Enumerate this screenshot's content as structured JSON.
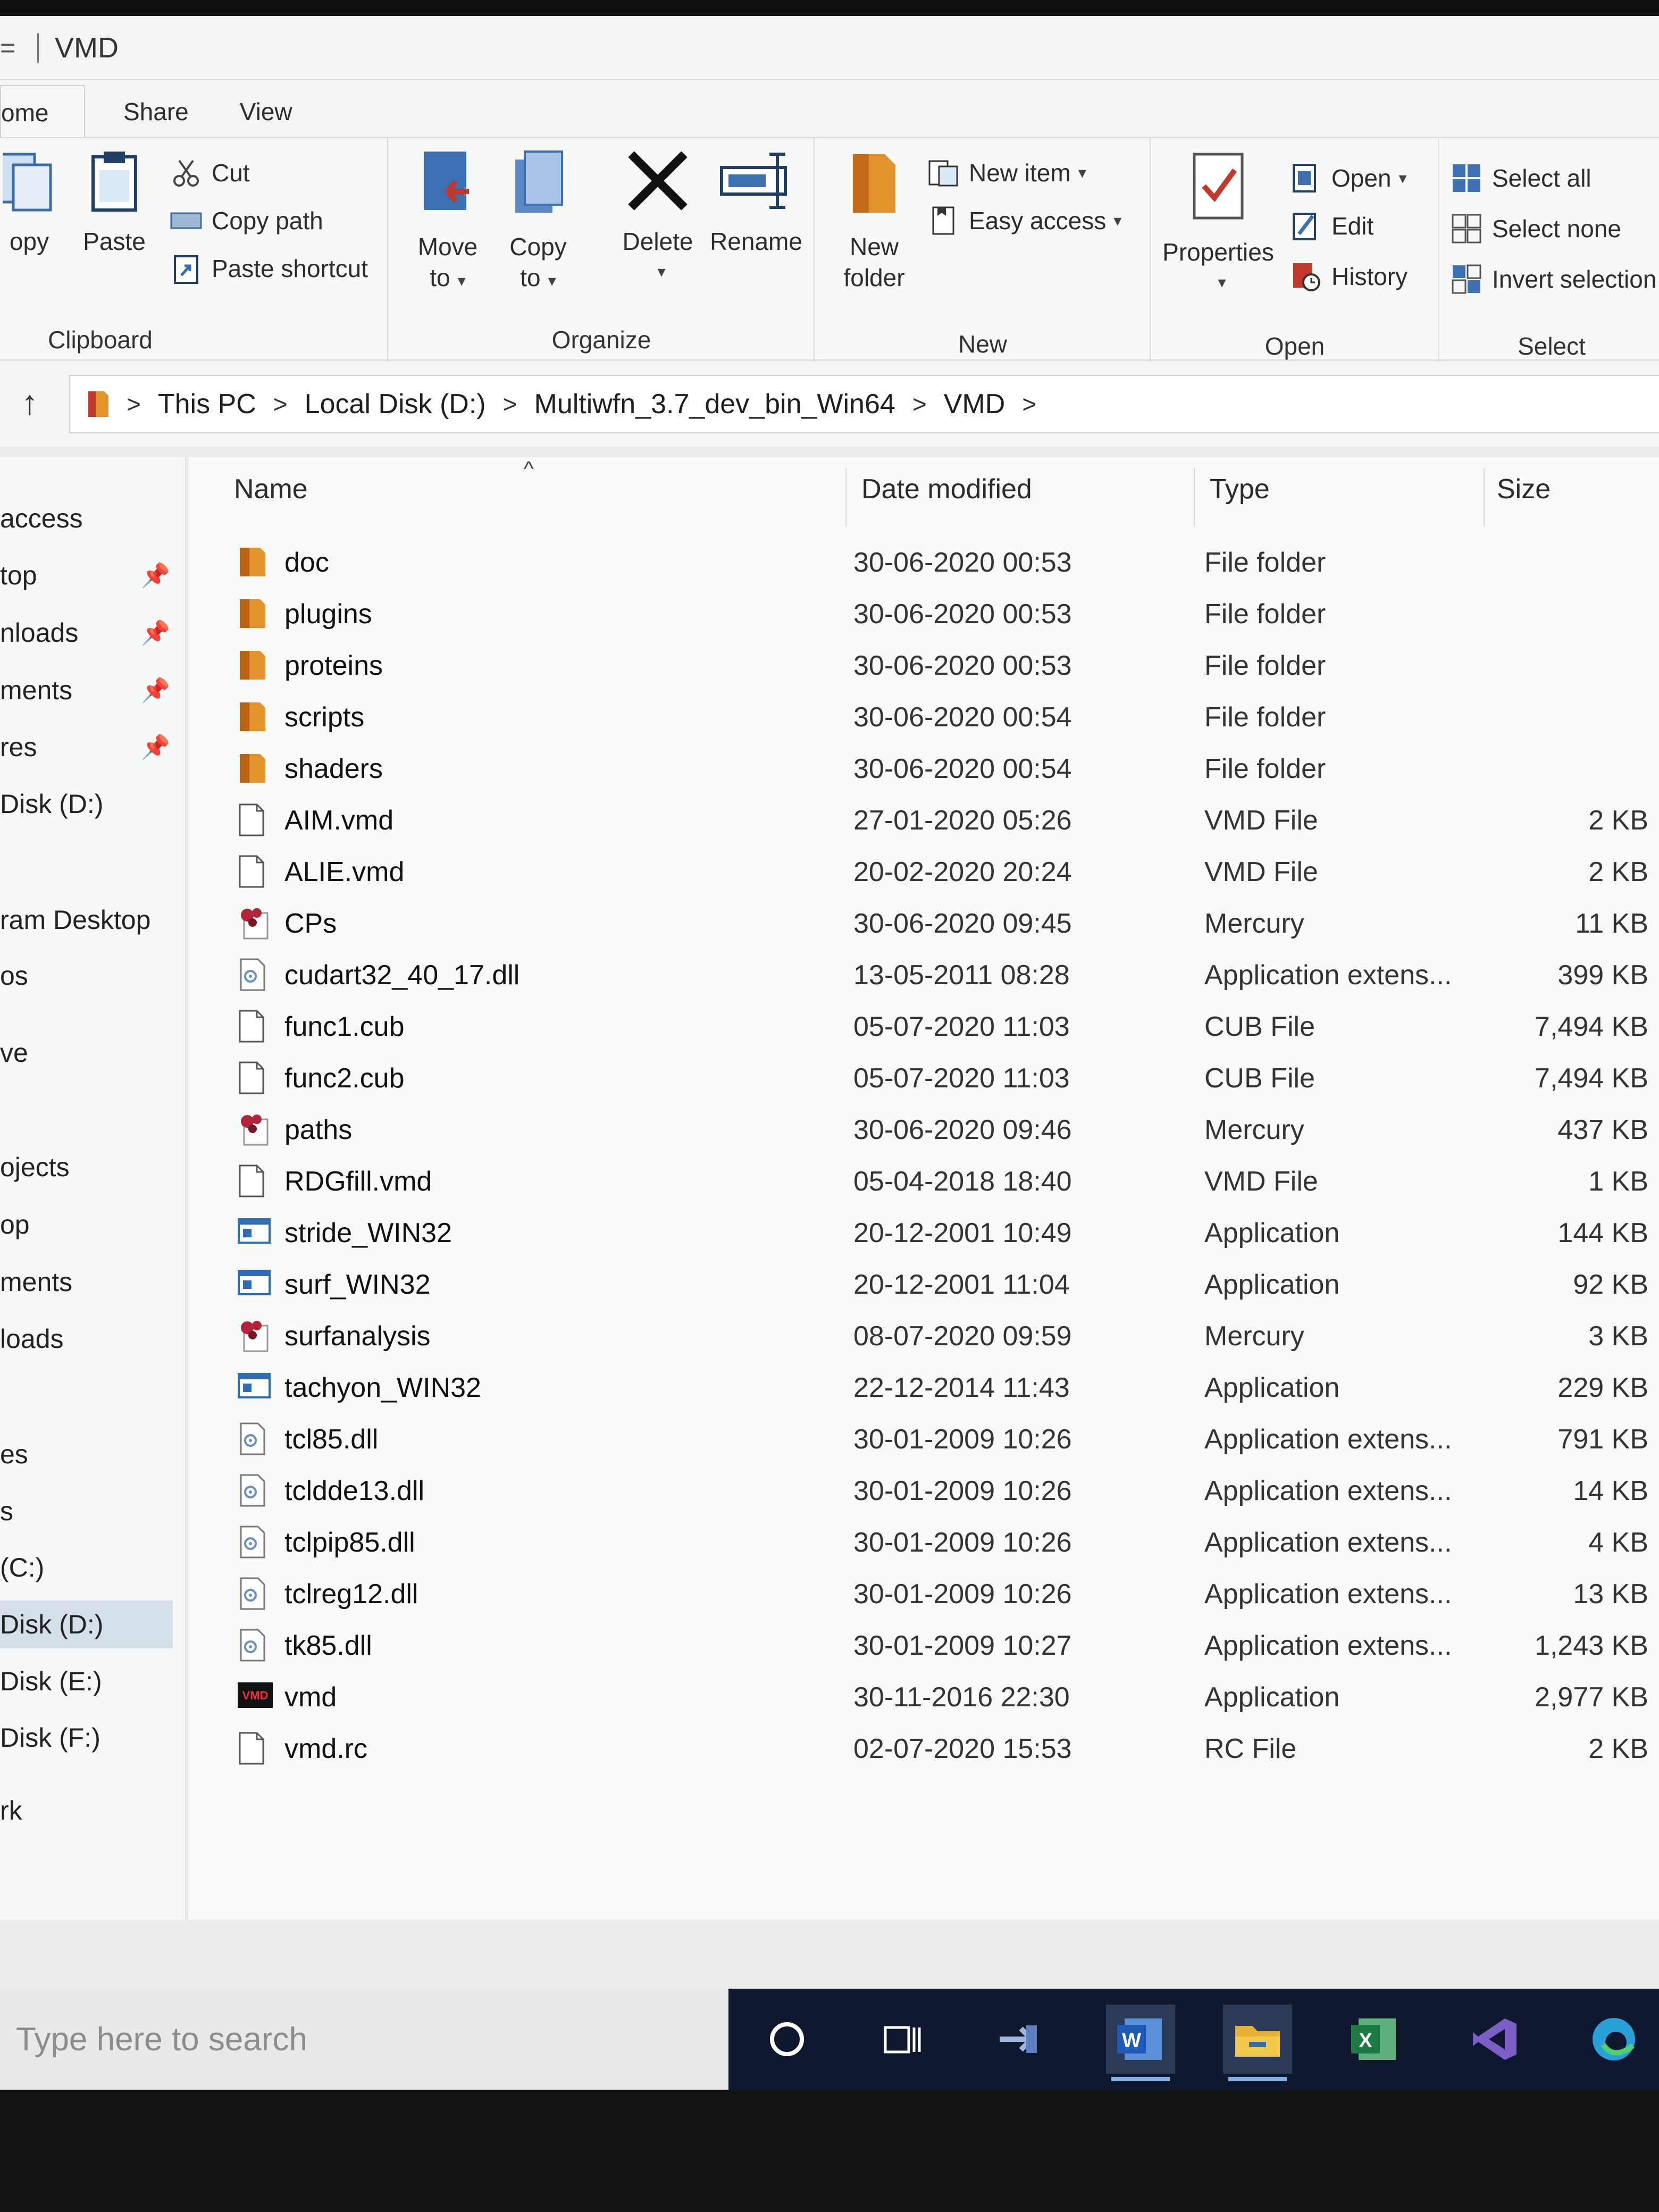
{
  "window": {
    "title": "VMD",
    "quick_access": "="
  },
  "tabs": [
    "ome",
    "Share",
    "View"
  ],
  "ribbon": {
    "clipboard": {
      "label": "Clipboard",
      "copy": "opy",
      "paste": "Paste",
      "cut": "Cut",
      "copy_path": "Copy path",
      "paste_shortcut": "Paste shortcut"
    },
    "organize": {
      "label": "Organize",
      "move_to": "Move",
      "move_to_2": "to",
      "copy_to": "Copy",
      "copy_to_2": "to",
      "delete": "Delete",
      "rename": "Rename"
    },
    "new": {
      "label": "New",
      "new_folder": "New",
      "new_folder_2": "folder",
      "new_item": "New item",
      "easy_access": "Easy access"
    },
    "open": {
      "label": "Open",
      "properties": "Properties",
      "open": "Open",
      "edit": "Edit",
      "history": "History"
    },
    "select": {
      "label": "Select",
      "select_all": "Select all",
      "select_none": "Select none",
      "invert": "Invert selection"
    }
  },
  "breadcrumb": [
    "This PC",
    "Local Disk (D:)",
    "Multiwfn_3.7_dev_bin_Win64",
    "VMD"
  ],
  "nav": [
    "access",
    "top",
    "nloads",
    "ments",
    "res",
    " Disk (D:)",
    "ram Desktop",
    "os",
    "ve",
    "ojects",
    "op",
    "ments",
    "loads",
    "es",
    "s",
    "(C:)",
    "Disk (D:)",
    "Disk (E:)",
    "Disk (F:)",
    "rk"
  ],
  "columns": {
    "name": "Name",
    "date": "Date modified",
    "type": "Type",
    "size": "Size"
  },
  "files": [
    {
      "name": "doc",
      "date": "30-06-2020 00:53",
      "type": "File folder",
      "size": "",
      "icon": "folder"
    },
    {
      "name": "plugins",
      "date": "30-06-2020 00:53",
      "type": "File folder",
      "size": "",
      "icon": "folder"
    },
    {
      "name": "proteins",
      "date": "30-06-2020 00:53",
      "type": "File folder",
      "size": "",
      "icon": "folder"
    },
    {
      "name": "scripts",
      "date": "30-06-2020 00:54",
      "type": "File folder",
      "size": "",
      "icon": "folder"
    },
    {
      "name": "shaders",
      "date": "30-06-2020 00:54",
      "type": "File folder",
      "size": "",
      "icon": "folder"
    },
    {
      "name": "AIM.vmd",
      "date": "27-01-2020 05:26",
      "type": "VMD File",
      "size": "2 KB",
      "icon": "file"
    },
    {
      "name": "ALIE.vmd",
      "date": "20-02-2020 20:24",
      "type": "VMD File",
      "size": "2 KB",
      "icon": "file"
    },
    {
      "name": "CPs",
      "date": "30-06-2020 09:45",
      "type": "Mercury",
      "size": "11 KB",
      "icon": "mercury"
    },
    {
      "name": "cudart32_40_17.dll",
      "date": "13-05-2011 08:28",
      "type": "Application extens...",
      "size": "399 KB",
      "icon": "dll"
    },
    {
      "name": "func1.cub",
      "date": "05-07-2020 11:03",
      "type": "CUB File",
      "size": "7,494 KB",
      "icon": "file"
    },
    {
      "name": "func2.cub",
      "date": "05-07-2020 11:03",
      "type": "CUB File",
      "size": "7,494 KB",
      "icon": "file"
    },
    {
      "name": "paths",
      "date": "30-06-2020 09:46",
      "type": "Mercury",
      "size": "437 KB",
      "icon": "mercury"
    },
    {
      "name": "RDGfill.vmd",
      "date": "05-04-2018 18:40",
      "type": "VMD File",
      "size": "1 KB",
      "icon": "file"
    },
    {
      "name": "stride_WIN32",
      "date": "20-12-2001 10:49",
      "type": "Application",
      "size": "144 KB",
      "icon": "app"
    },
    {
      "name": "surf_WIN32",
      "date": "20-12-2001 11:04",
      "type": "Application",
      "size": "92 KB",
      "icon": "app"
    },
    {
      "name": "surfanalysis",
      "date": "08-07-2020 09:59",
      "type": "Mercury",
      "size": "3 KB",
      "icon": "mercury"
    },
    {
      "name": "tachyon_WIN32",
      "date": "22-12-2014 11:43",
      "type": "Application",
      "size": "229 KB",
      "icon": "app"
    },
    {
      "name": "tcl85.dll",
      "date": "30-01-2009 10:26",
      "type": "Application extens...",
      "size": "791 KB",
      "icon": "dll"
    },
    {
      "name": "tcldde13.dll",
      "date": "30-01-2009 10:26",
      "type": "Application extens...",
      "size": "14 KB",
      "icon": "dll"
    },
    {
      "name": "tclpip85.dll",
      "date": "30-01-2009 10:26",
      "type": "Application extens...",
      "size": "4 KB",
      "icon": "dll"
    },
    {
      "name": "tclreg12.dll",
      "date": "30-01-2009 10:26",
      "type": "Application extens...",
      "size": "13 KB",
      "icon": "dll"
    },
    {
      "name": "tk85.dll",
      "date": "30-01-2009 10:27",
      "type": "Application extens...",
      "size": "1,243 KB",
      "icon": "dll"
    },
    {
      "name": "vmd",
      "date": "30-11-2016 22:30",
      "type": "Application",
      "size": "2,977 KB",
      "icon": "vmd"
    },
    {
      "name": "vmd.rc",
      "date": "02-07-2020 15:53",
      "type": "RC File",
      "size": "2 KB",
      "icon": "file"
    }
  ],
  "taskbar": {
    "search_placeholder": "Type here to search",
    "icons": [
      "cortana-icon",
      "task-view-icon",
      "app-arrow-icon",
      "word-icon",
      "file-explorer-icon",
      "excel-icon",
      "visual-studio-icon",
      "edge-icon"
    ]
  },
  "colors": {
    "folder": "#e2932b",
    "accent": "#2f6db5",
    "taskbar": "#101830"
  }
}
